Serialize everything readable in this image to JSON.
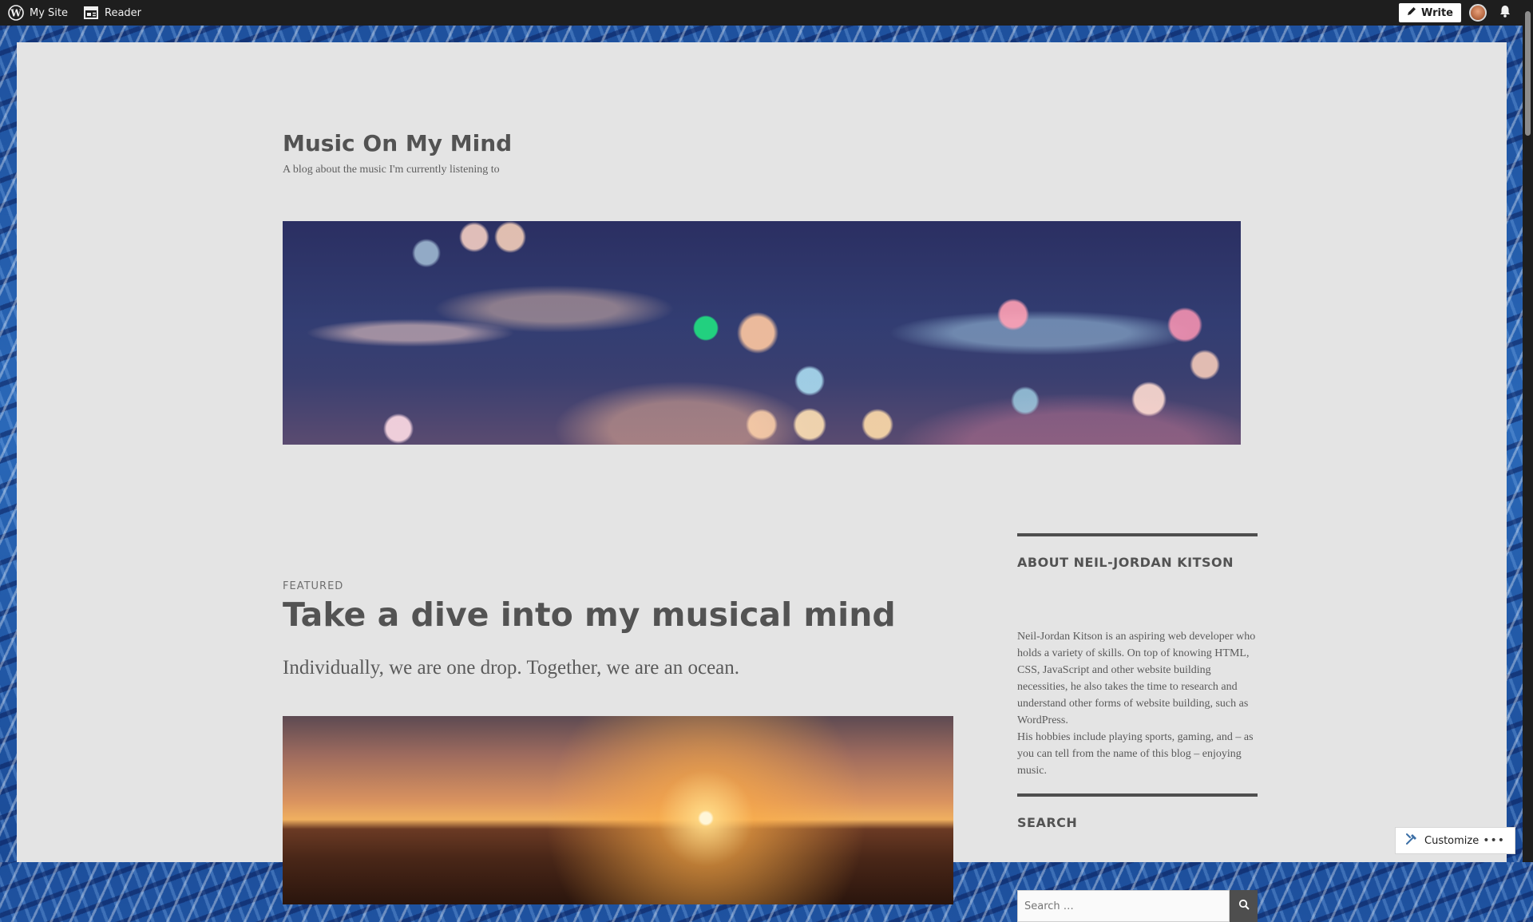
{
  "admin_bar": {
    "my_site_label": "My Site",
    "reader_label": "Reader",
    "write_label": "Write"
  },
  "site": {
    "title": "Music On My Mind",
    "description": "A blog about the music I'm currently listening to"
  },
  "post": {
    "label": "FEATURED",
    "title": "Take a dive into my musical mind",
    "excerpt": "Individually, we are one drop. Together, we are an ocean."
  },
  "sidebar": {
    "about": {
      "title": "ABOUT NEIL-JORDAN KITSON",
      "paragraph_1": "Neil-Jordan Kitson is an aspiring web developer who holds a variety of skills. On top of knowing HTML, CSS, JavaScript and other website building necessities, he also takes the time to research and understand other forms of website building, such as WordPress.",
      "paragraph_2": "His hobbies include playing sports, gaming, and – as you can tell from the name of this blog – enjoying music."
    },
    "search": {
      "title": "SEARCH",
      "placeholder": "Search …"
    }
  },
  "customize": {
    "label": "Customize",
    "more_label": "•••"
  },
  "icons": {
    "wordpress": "wordpress-logo-icon",
    "reader": "reader-icon",
    "write": "pencil-icon",
    "notifications": "bell-icon",
    "search": "search-icon",
    "customize": "customize-icon"
  },
  "colors": {
    "admin_bar": "#1e1e1e",
    "sheet": "#e4e4e4",
    "text": "#535353"
  }
}
